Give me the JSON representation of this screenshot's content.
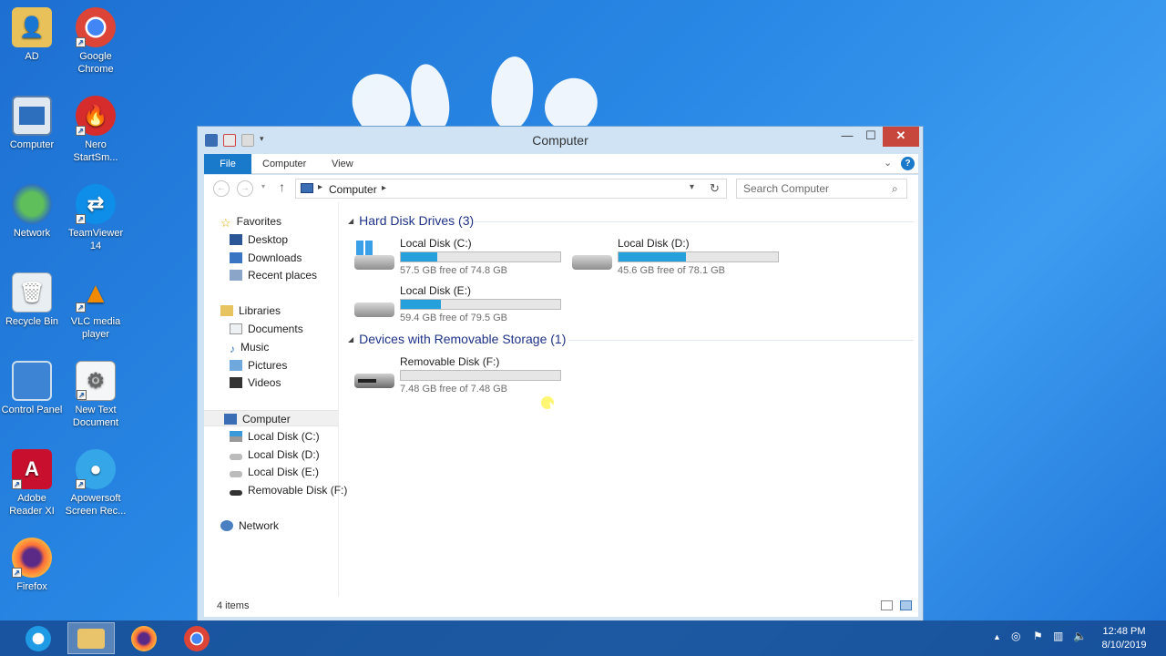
{
  "desktop": {
    "icons": [
      {
        "label": "AD",
        "icon": "folder-user-icon"
      },
      {
        "label": "Google Chrome",
        "icon": "chrome-icon"
      },
      {
        "label": "Computer",
        "icon": "computer-icon"
      },
      {
        "label": "Nero StartSm...",
        "icon": "nero-icon"
      },
      {
        "label": "Network",
        "icon": "network-icon"
      },
      {
        "label": "TeamViewer 14",
        "icon": "teamviewer-icon"
      },
      {
        "label": "Recycle Bin",
        "icon": "recycle-bin-icon"
      },
      {
        "label": "VLC media player",
        "icon": "vlc-icon"
      },
      {
        "label": "Control Panel",
        "icon": "control-panel-icon"
      },
      {
        "label": "New Text Document",
        "icon": "text-document-icon"
      },
      {
        "label": "Adobe Reader XI",
        "icon": "adobe-reader-icon"
      },
      {
        "label": "Apowersoft Screen Rec...",
        "icon": "apowersoft-icon"
      },
      {
        "label": "Firefox",
        "icon": "firefox-icon"
      }
    ]
  },
  "window": {
    "title": "Computer",
    "controls": {
      "minimize": "—",
      "maximize": "☐",
      "close": "✕"
    },
    "ribbon_tabs": {
      "file": "File",
      "computer": "Computer",
      "view": "View"
    },
    "help": "?",
    "address": {
      "crumb": "Computer"
    },
    "search": {
      "placeholder": "Search Computer"
    },
    "nav": {
      "favorites": "Favorites",
      "desktop": "Desktop",
      "downloads": "Downloads",
      "recent": "Recent places",
      "libraries": "Libraries",
      "documents": "Documents",
      "music": "Music",
      "pictures": "Pictures",
      "videos": "Videos",
      "computer": "Computer",
      "disk_c": "Local Disk (C:)",
      "disk_d": "Local Disk (D:)",
      "disk_e": "Local Disk (E:)",
      "disk_f": "Removable Disk (F:)",
      "network": "Network"
    },
    "groups": {
      "hard_disks": "Hard Disk Drives (3)",
      "removable": "Devices with Removable Storage (1)"
    },
    "drives": [
      {
        "name": "Local Disk (C:)",
        "free": "57.5 GB free of 74.8 GB",
        "used_fraction": 0.23
      },
      {
        "name": "Local Disk (D:)",
        "free": "45.6 GB free of 78.1 GB",
        "used_fraction": 0.42
      },
      {
        "name": "Local Disk (E:)",
        "free": "59.4 GB free of 79.5 GB",
        "used_fraction": 0.25
      },
      {
        "name": "Removable Disk (F:)",
        "free": "7.48 GB free of 7.48 GB",
        "used_fraction": 0.0
      }
    ],
    "status": {
      "items": "4 items"
    }
  },
  "taskbar": {
    "clock_time": "12:48 PM",
    "clock_date": "8/10/2019"
  },
  "colors": {
    "accent": "#1979ca",
    "bar_fill": "#26a0da",
    "close_red": "#c7473d",
    "group_header": "#1e3287"
  }
}
